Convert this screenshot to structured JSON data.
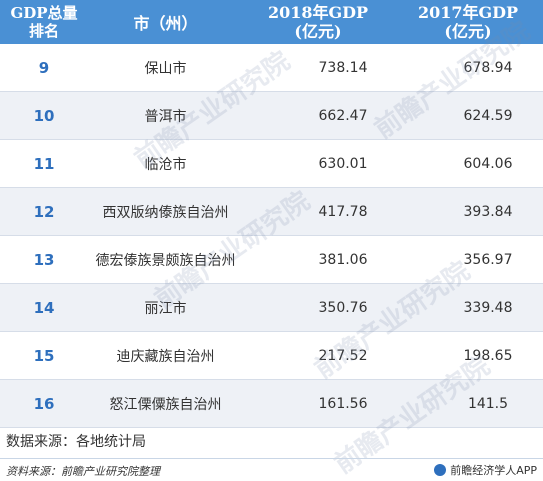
{
  "header": {
    "rank_line1": "GDP总量",
    "rank_line2": "排名",
    "city": "市（州）",
    "gdp2018_line1": "2018年GDP",
    "gdp2018_line2": "(亿元)",
    "gdp2017_line1": "2017年GDP",
    "gdp2017_line2": "(亿元)"
  },
  "rows": [
    {
      "rank": "9",
      "city": "保山市",
      "gdp2018": "738.14",
      "gdp2017": "678.94"
    },
    {
      "rank": "10",
      "city": "普洱市",
      "gdp2018": "662.47",
      "gdp2017": "624.59"
    },
    {
      "rank": "11",
      "city": "临沧市",
      "gdp2018": "630.01",
      "gdp2017": "604.06"
    },
    {
      "rank": "12",
      "city": "西双版纳傣族自治州",
      "gdp2018": "417.78",
      "gdp2017": "393.84"
    },
    {
      "rank": "13",
      "city": "德宏傣族景颇族自治州",
      "gdp2018": "381.06",
      "gdp2017": "356.97"
    },
    {
      "rank": "14",
      "city": "丽江市",
      "gdp2018": "350.76",
      "gdp2017": "339.48"
    },
    {
      "rank": "15",
      "city": "迪庆藏族自治州",
      "gdp2018": "217.52",
      "gdp2017": "198.65"
    },
    {
      "rank": "16",
      "city": "怒江傈僳族自治州",
      "gdp2018": "161.56",
      "gdp2017": "141.5"
    }
  ],
  "source_text": "数据来源：各地统计局",
  "credit_text": "资料来源：前瞻产业研究院整理",
  "brand_text": "前瞻经济学人APP",
  "watermark_text": "前瞻产业研究院",
  "colors": {
    "header_bg": "#4a90d4",
    "rank_text": "#2e6fbd",
    "alt_row_bg": "#eef1f6"
  }
}
